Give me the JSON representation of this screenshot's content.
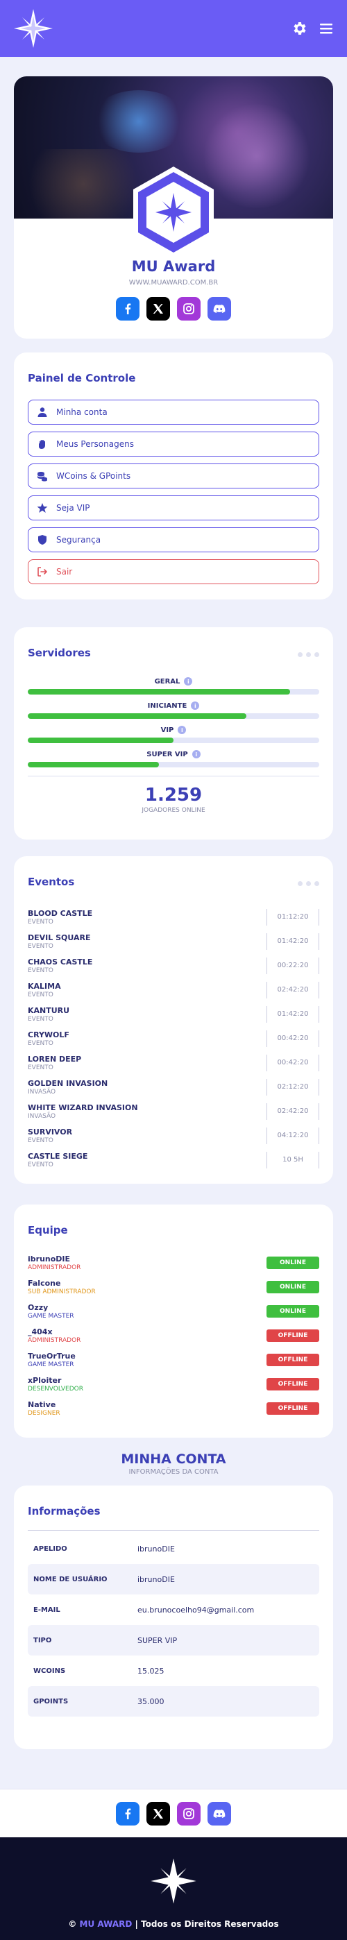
{
  "header": {
    "logo_icon": "star-logo-icon",
    "settings_icon": "gear-icon",
    "menu_icon": "hamburger-icon",
    "bg_color": "#6a5cf5"
  },
  "profile": {
    "name": "MU Award",
    "url": "WWW.MUAWARD.COM.BR"
  },
  "socials": [
    "facebook-icon",
    "x-icon",
    "instagram-icon",
    "discord-icon"
  ],
  "panel": {
    "title": "Painel de Controle",
    "items": [
      {
        "label": "Minha conta",
        "icon": "user-icon"
      },
      {
        "label": "Meus Personagens",
        "icon": "fist-icon"
      },
      {
        "label": "WCoins & GPoints",
        "icon": "coins-icon"
      },
      {
        "label": "Seja VIP",
        "icon": "star-icon"
      },
      {
        "label": "Segurança",
        "icon": "shield-icon"
      },
      {
        "label": "Sair",
        "icon": "logout-icon"
      }
    ]
  },
  "servers": {
    "title": "Servidores",
    "list": [
      {
        "name": "GERAL",
        "fill": 0.9
      },
      {
        "name": "INICIANTE",
        "fill": 0.75
      },
      {
        "name": "VIP",
        "fill": 0.5
      },
      {
        "name": "SUPER VIP",
        "fill": 0.45
      }
    ],
    "online_count": "1.259",
    "online_label": "JOGADORES ONLINE"
  },
  "events": {
    "title": "Eventos",
    "list": [
      {
        "name": "BLOOD CASTLE",
        "type": "EVENTO",
        "time": "01:12:20"
      },
      {
        "name": "DEVIL SQUARE",
        "type": "EVENTO",
        "time": "01:42:20"
      },
      {
        "name": "CHAOS CASTLE",
        "type": "EVENTO",
        "time": "00:22:20"
      },
      {
        "name": "KALIMA",
        "type": "EVENTO",
        "time": "02:42:20"
      },
      {
        "name": "KANTURU",
        "type": "EVENTO",
        "time": "01:42:20"
      },
      {
        "name": "CRYWOLF",
        "type": "EVENTO",
        "time": "00:42:20"
      },
      {
        "name": "LOREN DEEP",
        "type": "EVENTO",
        "time": "00:42:20"
      },
      {
        "name": "GOLDEN INVASION",
        "type": "INVASÃO",
        "time": "02:12:20"
      },
      {
        "name": "WHITE WIZARD INVASION",
        "type": "INVASÃO",
        "time": "02:42:20"
      },
      {
        "name": "SURVIVOR",
        "type": "EVENTO",
        "time": "04:12:20"
      },
      {
        "name": "CASTLE SIEGE",
        "type": "EVENTO",
        "time": "10 5H"
      }
    ]
  },
  "team": {
    "title": "Equipe",
    "members": [
      {
        "name": "ibrunoDIE",
        "role": "ADMINISTRADOR",
        "role_color": "#e04548",
        "status": "ONLINE",
        "online": true
      },
      {
        "name": "Falcone",
        "role": "SUB ADMINISTRADOR",
        "role_color": "#e0961a",
        "status": "ONLINE",
        "online": true
      },
      {
        "name": "Ozzy",
        "role": "GAME MASTER",
        "role_color": "#3b3fb5",
        "status": "ONLINE",
        "online": true
      },
      {
        "name": "_404x",
        "role": "ADMINISTRADOR",
        "role_color": "#e04548",
        "status": "OFFLINE",
        "online": false
      },
      {
        "name": "TrueOrTrue",
        "role": "GAME MASTER",
        "role_color": "#3b3fb5",
        "status": "OFFLINE",
        "online": false
      },
      {
        "name": "xPloiter",
        "role": "DESENVOLVEDOR",
        "role_color": "#2fae4a",
        "status": "OFFLINE",
        "online": false
      },
      {
        "name": "Native",
        "role": "DESIGNER",
        "role_color": "#e0961a",
        "status": "OFFLINE",
        "online": false
      }
    ]
  },
  "account": {
    "heading": "MINHA CONTA",
    "subheading": "INFORMAÇÕES DA CONTA",
    "info_title": "Informações",
    "rows": [
      {
        "key": "APELIDO",
        "value": "ibrunoDIE"
      },
      {
        "key": "NOME DE USUÁRIO",
        "value": "ibrunoDIE"
      },
      {
        "key": "E-MAIL",
        "value": "eu.brunocoelho94@gmail.com"
      },
      {
        "key": "TIPO",
        "value": "SUPER VIP"
      },
      {
        "key": "WCOINS",
        "value": "15.025"
      },
      {
        "key": "GPOINTS",
        "value": "35.000"
      }
    ]
  },
  "footer": {
    "copyright_prefix": "©",
    "brand": "MU AWARD",
    "copyright_suffix": "| Todos os Direitos Reservados"
  }
}
